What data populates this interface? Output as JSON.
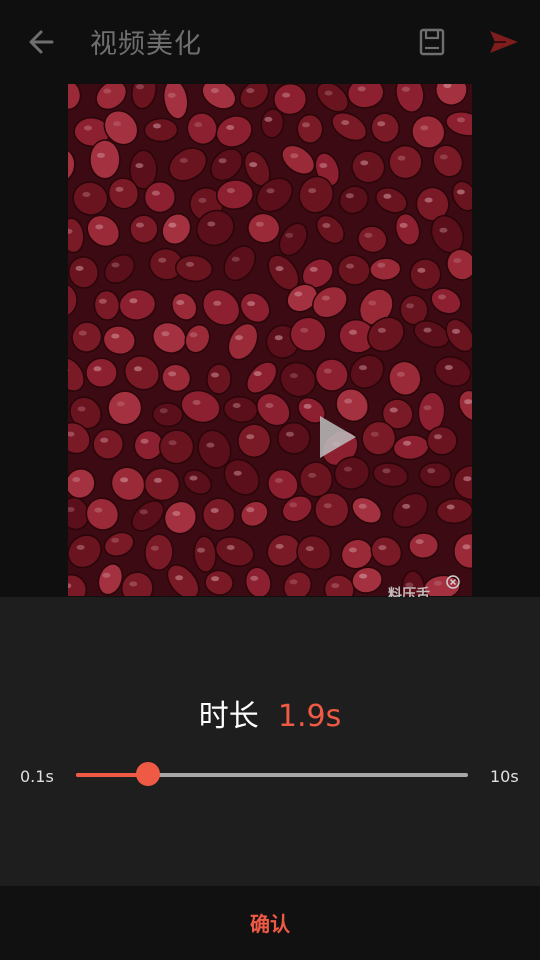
{
  "header": {
    "title": "视频美化",
    "back_icon": "arrow-left-icon",
    "save_icon": "save-icon",
    "send_icon": "send-icon"
  },
  "preview": {
    "play_icon": "play-icon",
    "watermark_text": "料压舌"
  },
  "duration": {
    "label": "时长",
    "value": "1.9s",
    "min_label": "0.1s",
    "max_label": "10s",
    "level": 0.183
  },
  "footer": {
    "confirm_label": "确认"
  },
  "colors": {
    "accent": "#ef5a44",
    "panel": "#1e1e1e",
    "background": "#0f0f0f"
  }
}
